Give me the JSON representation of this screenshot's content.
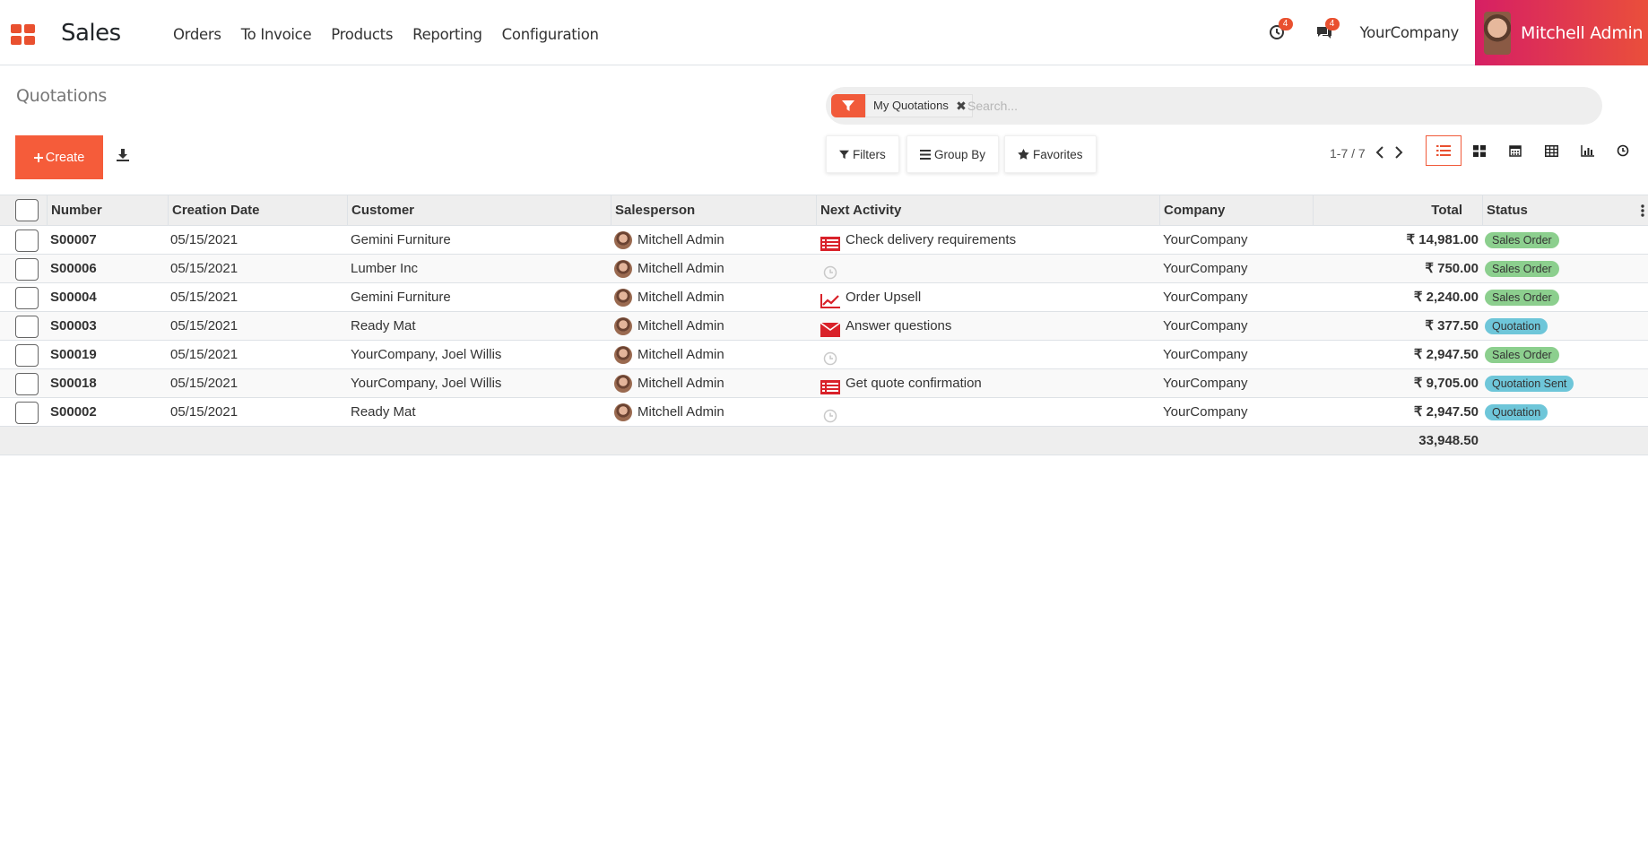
{
  "app": {
    "title": "Sales"
  },
  "menu": [
    "Orders",
    "To Invoice",
    "Products",
    "Reporting",
    "Configuration"
  ],
  "systray": {
    "activity_count": "4",
    "message_count": "4",
    "company": "YourCompany",
    "user": "Mitchell Admin"
  },
  "breadcrumb": "Quotations",
  "toolbar": {
    "create_label": "Create"
  },
  "search": {
    "facet": "My Quotations",
    "placeholder": "Search..."
  },
  "search_buttons": {
    "filters": "Filters",
    "group_by": "Group By",
    "favorites": "Favorites"
  },
  "pager": {
    "value": "1-7 / 7"
  },
  "table": {
    "headers": [
      "Number",
      "Creation Date",
      "Customer",
      "Salesperson",
      "Next Activity",
      "Company",
      "Total",
      "Status"
    ],
    "rows": [
      {
        "number": "S00007",
        "date": "05/15/2021",
        "customer": "Gemini Furniture",
        "salesperson": "Mitchell Admin",
        "activity_icon": "todo-list-icon",
        "activity": "Check delivery requirements",
        "company": "YourCompany",
        "total": "₹ 14,981.00",
        "status": "Sales Order",
        "status_kind": "green"
      },
      {
        "number": "S00006",
        "date": "05/15/2021",
        "customer": "Lumber Inc",
        "salesperson": "Mitchell Admin",
        "activity_icon": "clock-icon",
        "activity": "",
        "company": "YourCompany",
        "total": "₹ 750.00",
        "status": "Sales Order",
        "status_kind": "green"
      },
      {
        "number": "S00004",
        "date": "05/15/2021",
        "customer": "Gemini Furniture",
        "salesperson": "Mitchell Admin",
        "activity_icon": "upsell-chart-icon",
        "activity": "Order Upsell",
        "company": "YourCompany",
        "total": "₹ 2,240.00",
        "status": "Sales Order",
        "status_kind": "green"
      },
      {
        "number": "S00003",
        "date": "05/15/2021",
        "customer": "Ready Mat",
        "salesperson": "Mitchell Admin",
        "activity_icon": "envelope-icon",
        "activity": "Answer questions",
        "company": "YourCompany",
        "total": "₹ 377.50",
        "status": "Quotation",
        "status_kind": "cyan"
      },
      {
        "number": "S00019",
        "date": "05/15/2021",
        "customer": "YourCompany, Joel Willis",
        "salesperson": "Mitchell Admin",
        "activity_icon": "clock-icon",
        "activity": "",
        "company": "YourCompany",
        "total": "₹ 2,947.50",
        "status": "Sales Order",
        "status_kind": "green"
      },
      {
        "number": "S00018",
        "date": "05/15/2021",
        "customer": "YourCompany, Joel Willis",
        "salesperson": "Mitchell Admin",
        "activity_icon": "todo-list-icon",
        "activity": "Get quote confirmation",
        "company": "YourCompany",
        "total": "₹ 9,705.00",
        "status": "Quotation Sent",
        "status_kind": "cyan"
      },
      {
        "number": "S00002",
        "date": "05/15/2021",
        "customer": "Ready Mat",
        "salesperson": "Mitchell Admin",
        "activity_icon": "clock-icon",
        "activity": "",
        "company": "YourCompany",
        "total": "₹ 2,947.50",
        "status": "Quotation",
        "status_kind": "cyan"
      }
    ],
    "sum_total": "33,948.50"
  },
  "colors": {
    "brand": "#e9502f",
    "accent": "#f55c3a",
    "status_green": "#8ccf8e",
    "status_cyan": "#6ec6d9"
  }
}
